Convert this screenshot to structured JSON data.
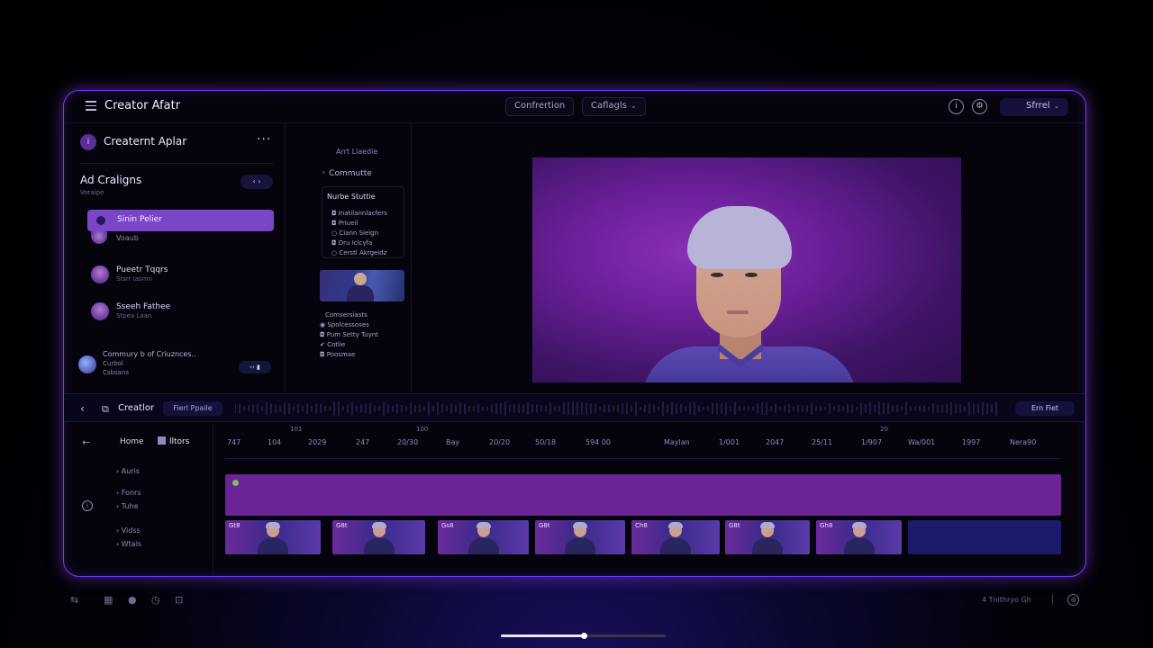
{
  "window": {
    "title": "Creator Afatr",
    "tab_left": "Confrertion",
    "tab_dropdown": "Caflagls",
    "info_icon": "i",
    "settings_icon": "⚙",
    "send_label": "Sfrrel"
  },
  "left_panel": {
    "profile_initial": "i",
    "profile_name": "Creaternt Aplar",
    "more_label": "···",
    "section_title": "Ad Craligns",
    "section_sub": "Voraipe",
    "arrow_label": "‹  ›",
    "active_item": "Sinin Pelier",
    "active_item_sub": "Voaub",
    "items": [
      {
        "name": "Pueetr Tqqrs",
        "sub": "Stsrr Iasmn"
      },
      {
        "name": "Sseeh Fathee",
        "sub": "Stpea Laan"
      }
    ],
    "community": {
      "line1": "Commury b of Criuznces..",
      "line2": "Curbol",
      "line3": "Csbsans",
      "controls": "‹‹  ▮"
    }
  },
  "mid_panel": {
    "title": "Arrt Llaedie",
    "check_label": "Commutte",
    "box_title": "Nurbe Stuttie",
    "box_rows": [
      "Inatilannlacfers",
      "Priueil",
      "Ciann Sielgn",
      "Dru Iclcyfa",
      "Cerstl Akrgeidz"
    ],
    "list": [
      "Comsersiasts",
      "Spolcessoses",
      "Pum Setty Tuynt",
      "Cotlie",
      "Poosmae"
    ]
  },
  "timeline_bar": {
    "label": "Creatlor",
    "pill": "Fierl Ppaile",
    "export_label": "Ern Fiet"
  },
  "ruler": {
    "top_marks": [
      "101",
      "100",
      "20"
    ],
    "labels": [
      "747",
      "104",
      "2029",
      "247",
      "20/30",
      "Bay",
      "20/20",
      "50/18",
      "594 00",
      "Maylan",
      "1/001",
      "2047",
      "25/11",
      "1/907",
      "Wa/001",
      "1997",
      "Nera90"
    ]
  },
  "side_nav": {
    "back_icon": "←",
    "home_label": "Home",
    "active_tab": "lltors",
    "info_icon": "i",
    "items": [
      "Auris",
      "Fonrs",
      "Tuhe",
      "Vidss",
      "Wtals"
    ]
  },
  "clips": [
    {
      "label": "Gt8"
    },
    {
      "label": "G8t"
    },
    {
      "label": "Gs8"
    },
    {
      "label": "G8t"
    },
    {
      "label": "Ch8"
    },
    {
      "label": "G8t"
    },
    {
      "label": "Gh8"
    }
  ],
  "bottom": {
    "status": "4 Tnithryo Gh",
    "globe_icon": "◍",
    "scrub_progress": 0.5
  }
}
